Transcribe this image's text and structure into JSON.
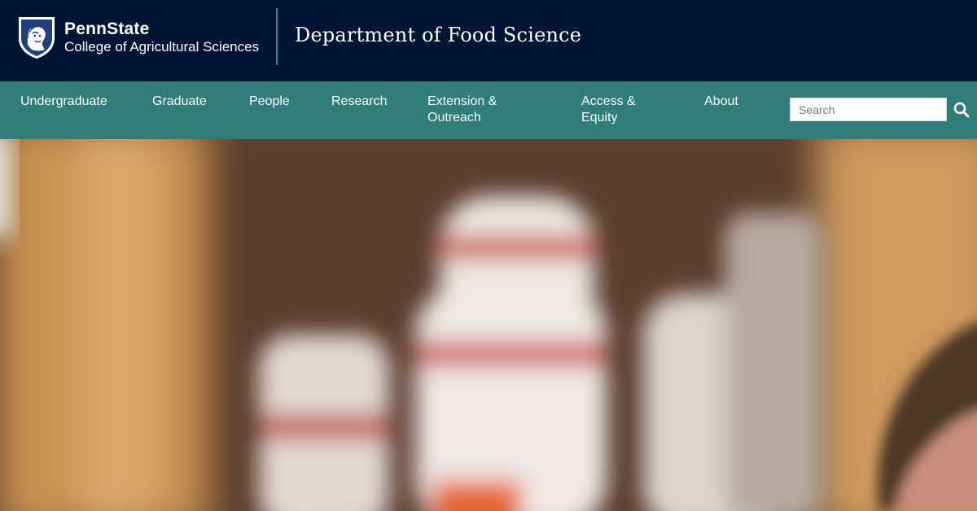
{
  "header": {
    "brand_name": "PennState",
    "college_name": "College of Agricultural Sciences",
    "department_title": "Department of Food Science",
    "background_color": "#001534",
    "divider_color": "#3a8d8a"
  },
  "nav": {
    "background_color": "#2f7e79",
    "items": [
      {
        "label": "Undergraduate"
      },
      {
        "label": "Graduate"
      },
      {
        "label": "People"
      },
      {
        "label": "Research"
      },
      {
        "label": "Extension & Outreach"
      },
      {
        "label": "Access & Equity"
      },
      {
        "label": "About"
      }
    ]
  },
  "search": {
    "placeholder": "Search",
    "value": "",
    "icon": "search-icon"
  },
  "hero": {
    "description_icon": "hero-image",
    "colors": {
      "cabinet": "#c9924f",
      "shadow": "#5a3d2e",
      "bottle": "#ece7e2",
      "label_red": "#c93d3a",
      "label_orange": "#e8632a"
    }
  }
}
